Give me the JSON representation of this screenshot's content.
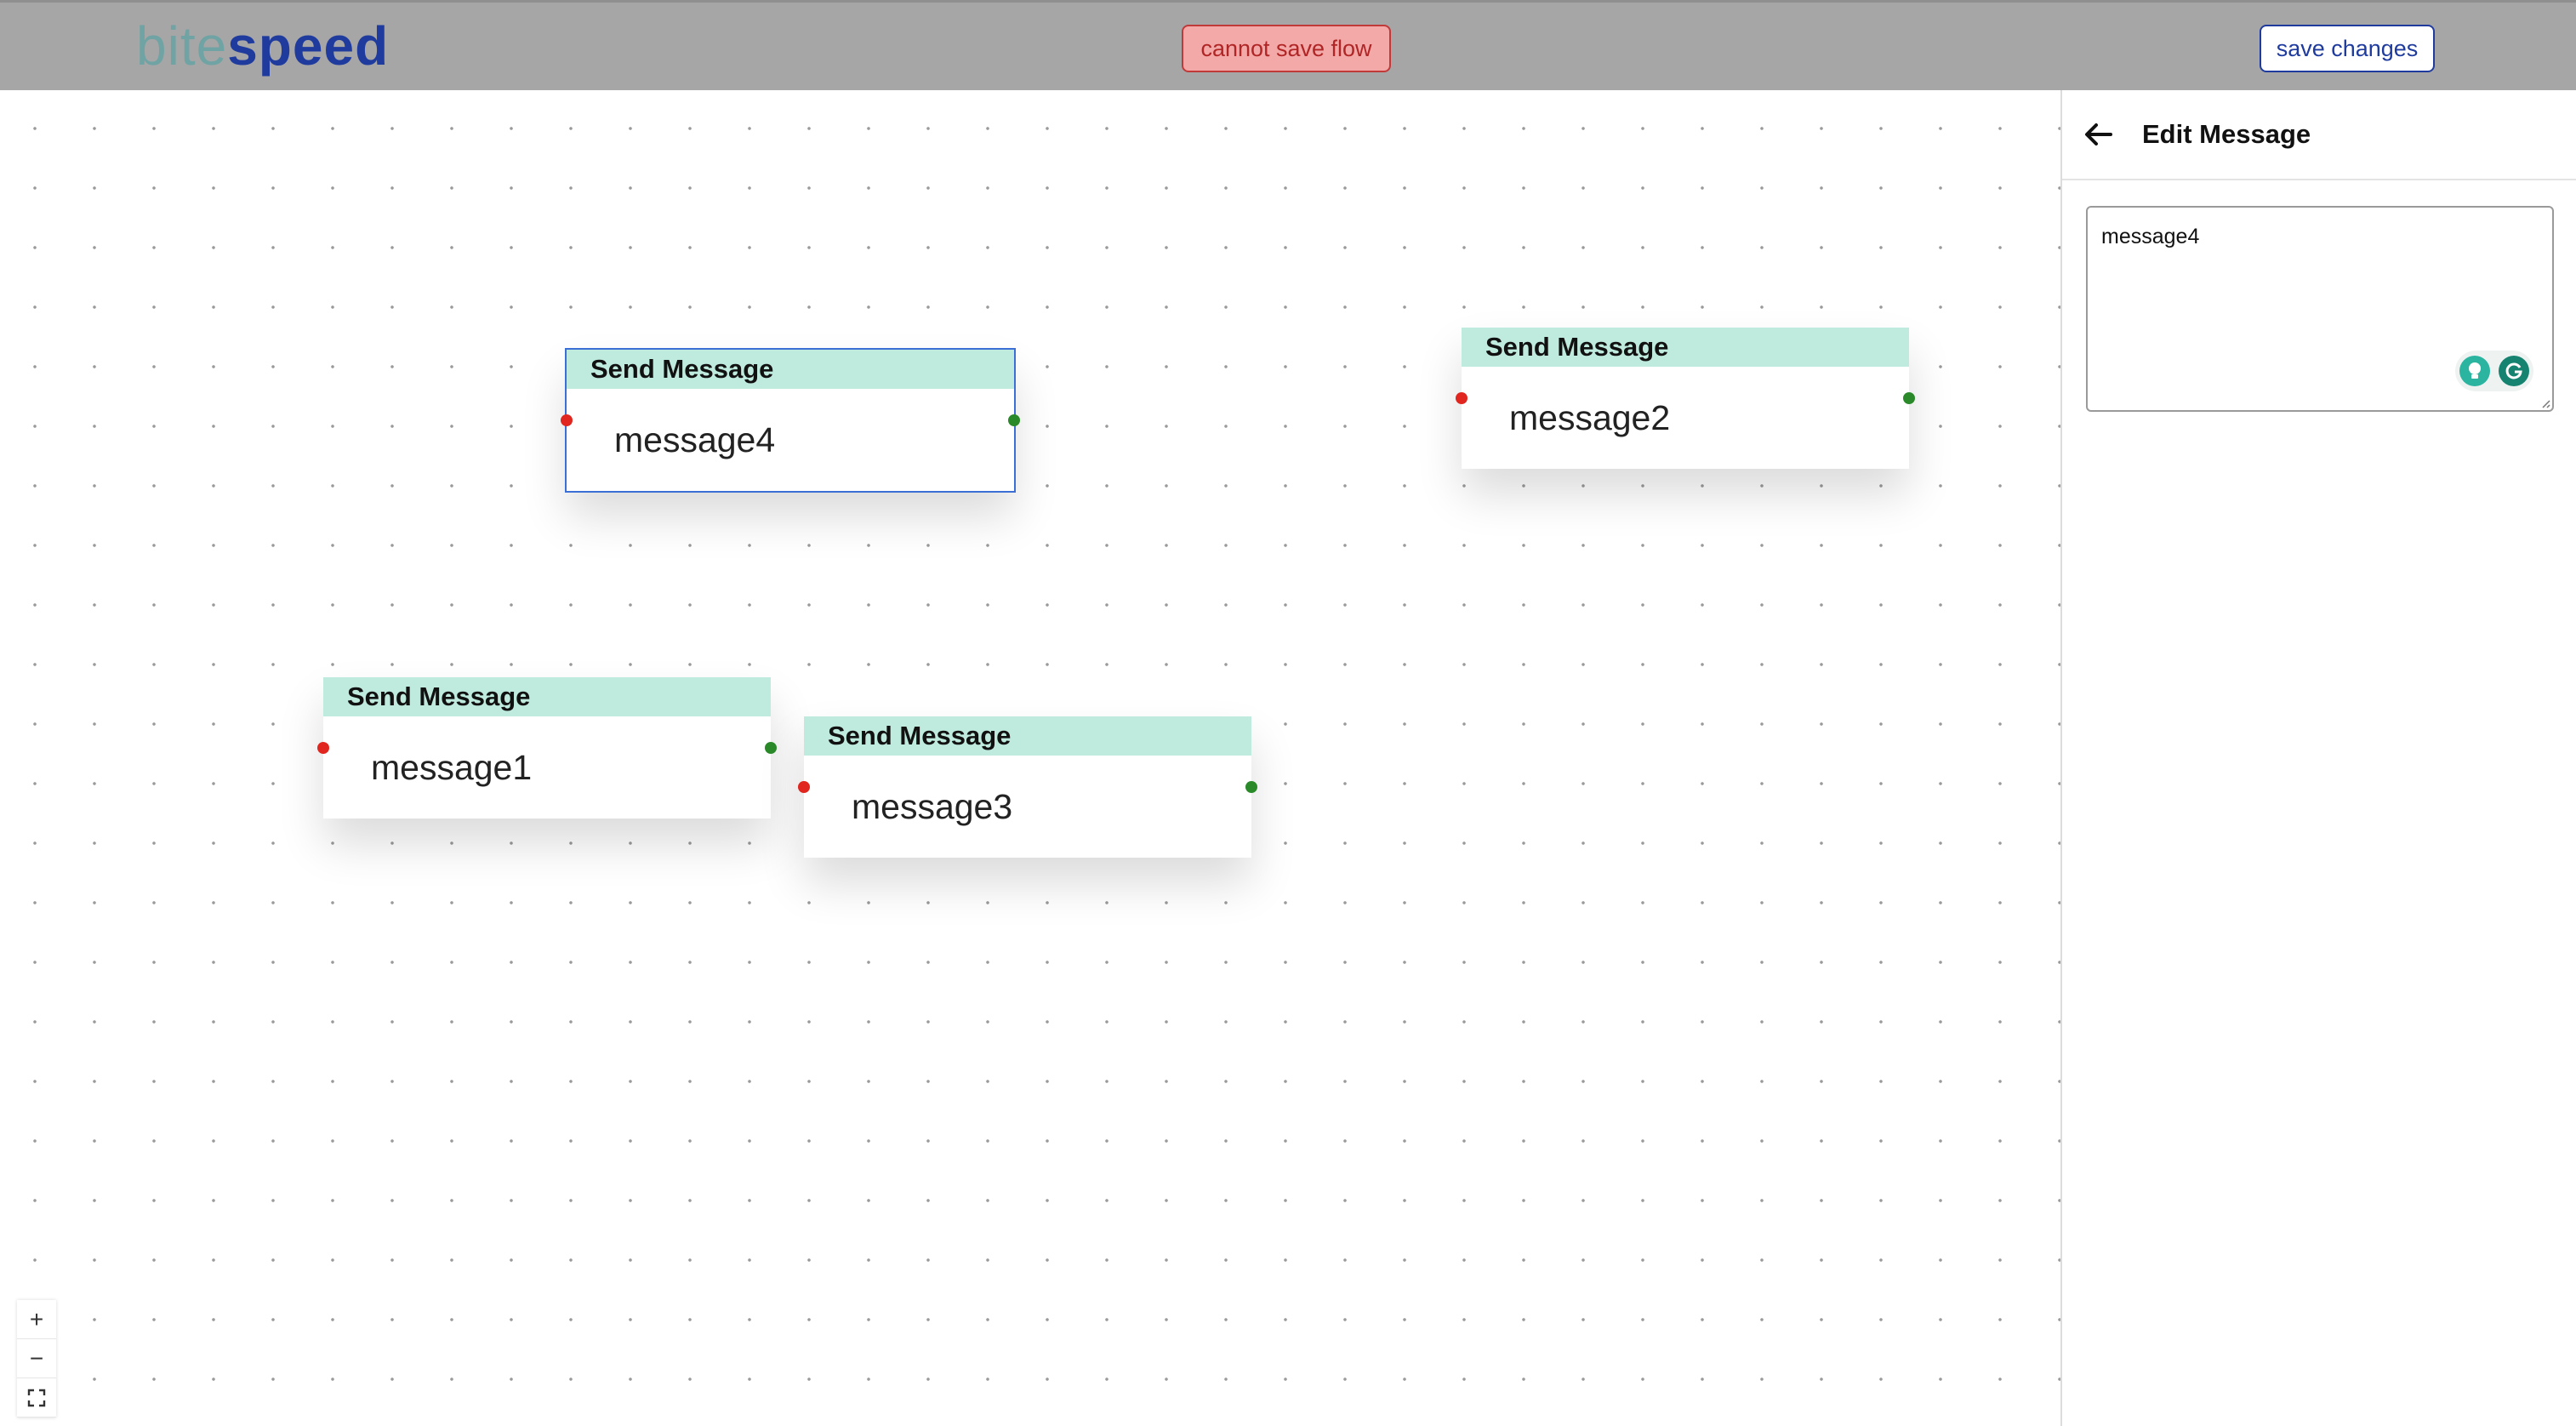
{
  "header": {
    "logo_light": "bite",
    "logo_bold": "speed",
    "error_label": "cannot save flow",
    "save_label": "save changes"
  },
  "canvas": {
    "nodes": [
      {
        "header": "Send Message",
        "text": "message4",
        "selected": true
      },
      {
        "header": "Send Message",
        "text": "message2",
        "selected": false
      },
      {
        "header": "Send Message",
        "text": "message1",
        "selected": false
      },
      {
        "header": "Send Message",
        "text": "message3",
        "selected": false
      }
    ],
    "controls": {
      "zoom_in": "+",
      "zoom_out": "−"
    }
  },
  "panel": {
    "title": "Edit Message",
    "message_value": "message4"
  },
  "colors": {
    "topbar": "#a6a6a6",
    "brand": "#1f3b9e",
    "error": "#c03a3a",
    "node_header": "#bfeade",
    "handle_in": "#e0261f",
    "handle_out": "#2a8a2a"
  },
  "icons": [
    "arrow-left-icon",
    "plus-icon",
    "minus-icon",
    "fit-view-icon",
    "lightbulb-icon",
    "grammarly-icon"
  ]
}
